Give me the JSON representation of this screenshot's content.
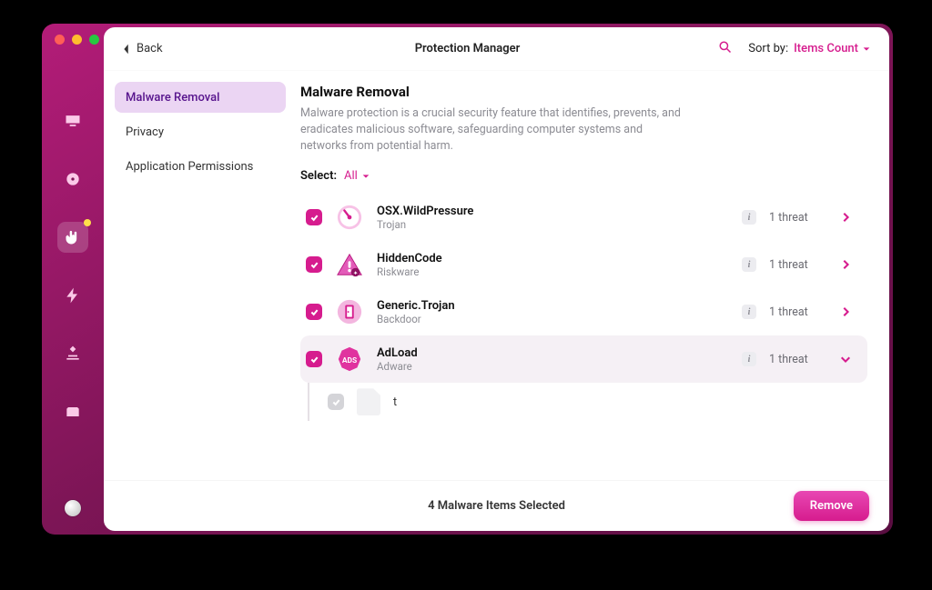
{
  "window": {
    "title": "Protection Manager",
    "back_label": "Back"
  },
  "sort": {
    "label": "Sort by:",
    "value": "Items Count"
  },
  "categories": [
    {
      "label": "Malware Removal",
      "active": true
    },
    {
      "label": "Privacy",
      "active": false
    },
    {
      "label": "Application Permissions",
      "active": false
    }
  ],
  "section": {
    "title": "Malware Removal",
    "description": "Malware protection is a crucial security feature that identifies, prevents, and eradicates malicious software, safeguarding computer systems and networks from potential harm."
  },
  "select": {
    "label": "Select:",
    "value": "All"
  },
  "threats": [
    {
      "name": "OSX.WildPressure",
      "type": "Trojan",
      "count_label": "1 threat",
      "checked": true,
      "expanded": false,
      "icon": "gauge"
    },
    {
      "name": "HiddenCode",
      "type": "Riskware",
      "count_label": "1 threat",
      "checked": true,
      "expanded": false,
      "icon": "warn"
    },
    {
      "name": "Generic.Trojan",
      "type": "Backdoor",
      "count_label": "1 threat",
      "checked": true,
      "expanded": false,
      "icon": "door"
    },
    {
      "name": "AdLoad",
      "type": "Adware",
      "count_label": "1 threat",
      "checked": true,
      "expanded": true,
      "icon": "ads",
      "files": [
        {
          "name": "t",
          "checked": true
        }
      ]
    }
  ],
  "footer": {
    "status": "4 Malware Items Selected",
    "remove_label": "Remove"
  },
  "info_glyph": "i"
}
